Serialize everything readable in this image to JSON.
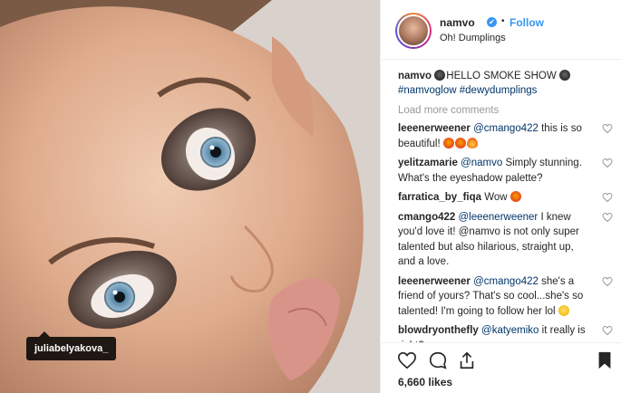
{
  "image": {
    "tag_label": "juliabelyakova_"
  },
  "header": {
    "username": "namvo",
    "verified_mark": "✔",
    "separator": "•",
    "follow_label": "Follow",
    "location": "Oh! Dumplings"
  },
  "caption": {
    "username": "namvo",
    "text": "HELLO SMOKE SHOW",
    "hashtags": "#namvoglow #dewydumplings"
  },
  "load_more_label": "Load more comments",
  "comments": [
    {
      "user": "leeenerweener",
      "mention": "@cmango422",
      "text": " this is so beautiful!",
      "emojis": [
        "e-red",
        "e-red",
        "e-fire"
      ]
    },
    {
      "user": "yelitzamarie",
      "mention": "@namvo",
      "text": " Simply stunning. What's the eyeshadow palette?",
      "emojis": []
    },
    {
      "user": "farratica_by_fiqa",
      "mention": "",
      "text": "Wow",
      "emojis": [
        "e-red"
      ]
    },
    {
      "user": "cmango422",
      "mention": "@leeenerweener",
      "text": " I knew you'd love it! @namvo is not only super talented but also hilarious, straight up, and a love.",
      "emojis": []
    },
    {
      "user": "leeenerweener",
      "mention": "@cmango422",
      "text": " she's a friend of yours? That's so cool...she's so talented! I'm going to follow her lol",
      "emojis": [
        "e-yellow"
      ]
    },
    {
      "user": "blowdryonthefly",
      "mention": "@katyemiko",
      "text": " it really is right?",
      "emojis": []
    }
  ],
  "actions": {
    "likes": "6,660 likes"
  },
  "colors": {
    "link": "#3897f0",
    "mention": "#003569",
    "muted": "#999999"
  }
}
